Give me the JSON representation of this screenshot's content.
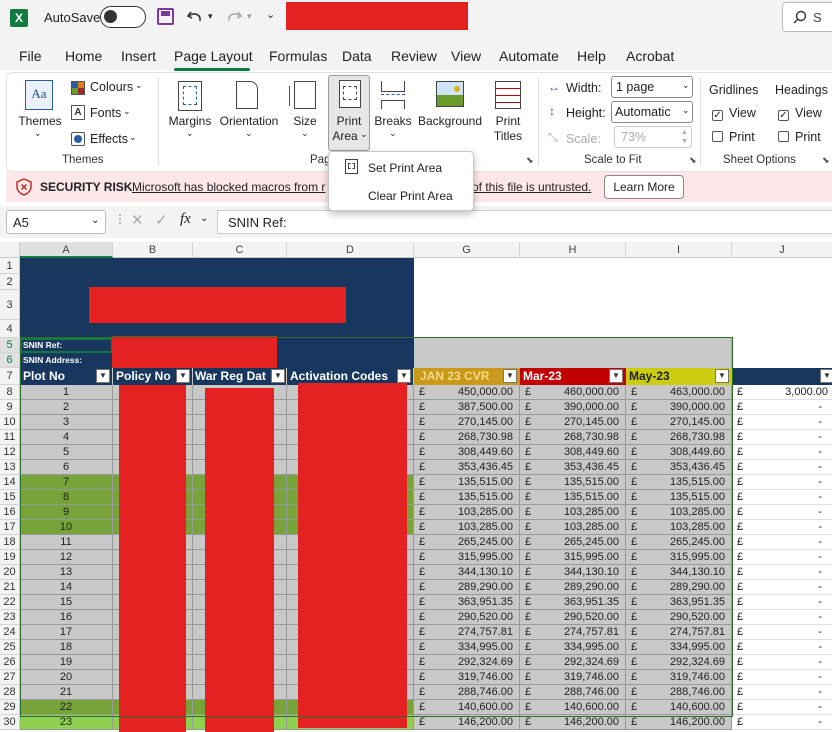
{
  "titlebar": {
    "autosave_label": "AutoSave",
    "autosave_state": "Off",
    "search_icon": "search-icon",
    "search_initial": "S"
  },
  "menu": {
    "items": [
      "File",
      "Home",
      "Insert",
      "Page Layout",
      "Formulas",
      "Data",
      "Review",
      "View",
      "Automate",
      "Help",
      "Acrobat"
    ],
    "active": "Page Layout"
  },
  "ribbon": {
    "themes": "Themes",
    "colours": "Colours",
    "fonts": "Fonts",
    "effects": "Effects",
    "themes_group": "Themes",
    "margins": "Margins",
    "orientation": "Orientation",
    "size": "Size",
    "print_area_1": "Print",
    "print_area_2": "Area",
    "breaks": "Breaks",
    "background": "Background",
    "print_titles_1": "Print",
    "print_titles_2": "Titles",
    "page_group": "Pag",
    "width_label": "Width:",
    "width_value": "1 page",
    "height_label": "Height:",
    "height_value": "Automatic",
    "scale_label": "Scale:",
    "scale_value": "73%",
    "scale_group": "Scale to Fit",
    "gridlines": "Gridlines",
    "headings": "Headings",
    "view": "View",
    "print": "Print",
    "sheet_group": "Sheet Options"
  },
  "dropdown": {
    "set": "Set Print Area",
    "clear": "Clear Print Area"
  },
  "security": {
    "title": "SECURITY RISK",
    "msg_a": "Microsoft has blocked macros from r",
    "msg_b": "of this file is untrusted.",
    "button": "Learn More"
  },
  "formula": {
    "namebox": "A5",
    "fx": "fx",
    "content": "SNIN Ref:"
  },
  "columns": [
    "A",
    "B",
    "C",
    "D",
    "G",
    "H",
    "I",
    "J"
  ],
  "sheet": {
    "snin_ref": "SNIN Ref:",
    "snin_address": "SNIN Address:",
    "headers": {
      "plot": "Plot No",
      "policy": "Policy No",
      "war": "War Reg Dat",
      "activation": "Activation Codes",
      "jan": "JAN 23 CVR",
      "mar": "Mar-23",
      "may": "May-23"
    },
    "currency": "£",
    "dash": "-",
    "j_first": "3,000.00"
  },
  "rows": [
    {
      "n": "1",
      "plot": "1",
      "g": "450,000.00",
      "h": "460,000.00",
      "i": "463,000.00"
    },
    {
      "n": "2",
      "plot": "2",
      "g": "387,500.00",
      "h": "390,000.00",
      "i": "390,000.00"
    },
    {
      "n": "3",
      "plot": "3",
      "g": "270,145.00",
      "h": "270,145.00",
      "i": "270,145.00"
    },
    {
      "n": "4",
      "plot": "4",
      "g": "268,730.98",
      "h": "268,730.98",
      "i": "268,730.98"
    },
    {
      "n": "5",
      "plot": "5",
      "g": "308,449.60",
      "h": "308,449.60",
      "i": "308,449.60"
    },
    {
      "n": "6",
      "plot": "6",
      "g": "353,436.45",
      "h": "353,436.45",
      "i": "353,436.45"
    },
    {
      "n": "7",
      "plot": "7",
      "g": "135,515.00",
      "h": "135,515.00",
      "i": "135,515.00"
    },
    {
      "n": "8",
      "plot": "8",
      "g": "135,515.00",
      "h": "135,515.00",
      "i": "135,515.00"
    },
    {
      "n": "9",
      "plot": "9",
      "g": "103,285.00",
      "h": "103,285.00",
      "i": "103,285.00"
    },
    {
      "n": "10",
      "plot": "10",
      "g": "103,285.00",
      "h": "103,285.00",
      "i": "103,285.00"
    },
    {
      "n": "11",
      "plot": "11",
      "g": "265,245.00",
      "h": "265,245.00",
      "i": "265,245.00"
    },
    {
      "n": "12",
      "plot": "12",
      "g": "315,995.00",
      "h": "315,995.00",
      "i": "315,995.00"
    },
    {
      "n": "13",
      "plot": "13",
      "g": "344,130.10",
      "h": "344,130.10",
      "i": "344,130.10"
    },
    {
      "n": "14",
      "plot": "14",
      "g": "289,290.00",
      "h": "289,290.00",
      "i": "289,290.00"
    },
    {
      "n": "15",
      "plot": "15",
      "g": "363,951.35",
      "h": "363,951.35",
      "i": "363,951.35"
    },
    {
      "n": "16",
      "plot": "16",
      "g": "290,520.00",
      "h": "290,520.00",
      "i": "290,520.00"
    },
    {
      "n": "17",
      "plot": "17",
      "g": "274,757.81",
      "h": "274,757.81",
      "i": "274,757.81"
    },
    {
      "n": "18",
      "plot": "18",
      "g": "334,995.00",
      "h": "334,995.00",
      "i": "334,995.00"
    },
    {
      "n": "19",
      "plot": "19",
      "g": "292,324.69",
      "h": "292,324.69",
      "i": "292,324.69"
    },
    {
      "n": "20",
      "plot": "20",
      "g": "319,746.00",
      "h": "319,746.00",
      "i": "319,746.00"
    },
    {
      "n": "21",
      "plot": "21",
      "g": "288,746.00",
      "h": "288,746.00",
      "i": "288,746.00"
    },
    {
      "n": "22",
      "plot": "22",
      "g": "140,600.00",
      "h": "140,600.00",
      "i": "140,600.00"
    },
    {
      "n": "23",
      "plot": "23",
      "g": "146,200.00",
      "h": "146,200.00",
      "i": "146,200.00"
    }
  ],
  "row_headers": [
    "1",
    "2",
    "3",
    "4",
    "5",
    "6",
    "7"
  ],
  "colors": {
    "navy": "#17375e",
    "green": "#76a33a",
    "grey": "#c8c8c8",
    "orange": "#c99a1a",
    "red": "#c00000",
    "yellow": "#cccc10",
    "redact": "#e52222",
    "accent": "#107c41"
  }
}
